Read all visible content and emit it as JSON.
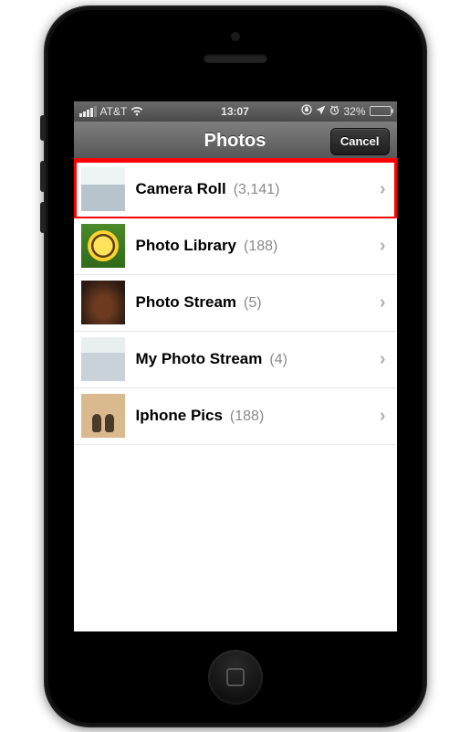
{
  "statusbar": {
    "carrier": "AT&T",
    "time": "13:07",
    "battery_pct": "32%"
  },
  "navbar": {
    "title": "Photos",
    "cancel": "Cancel"
  },
  "albums": [
    {
      "name": "Camera Roll",
      "count": "(3,141)",
      "thumb": "cam",
      "highlighted": true
    },
    {
      "name": "Photo Library",
      "count": "(188)",
      "thumb": "sun",
      "highlighted": false
    },
    {
      "name": "Photo Stream",
      "count": "(5)",
      "thumb": "food",
      "highlighted": false
    },
    {
      "name": "My Photo Stream",
      "count": "(4)",
      "thumb": "stream",
      "highlighted": false
    },
    {
      "name": "Iphone Pics",
      "count": "(188)",
      "thumb": "feet",
      "highlighted": false
    }
  ]
}
